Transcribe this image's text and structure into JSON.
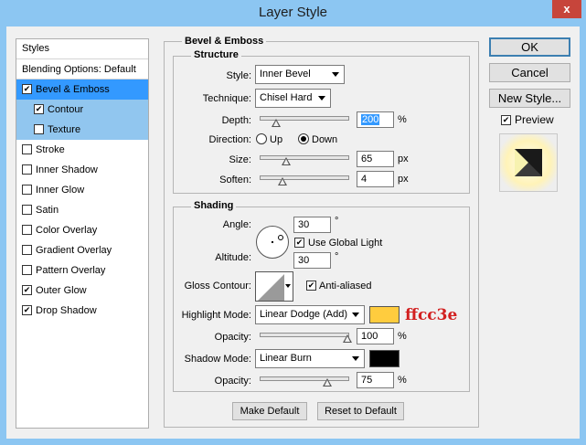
{
  "window": {
    "title": "Layer Style",
    "close_label": "x"
  },
  "styles_panel": {
    "header": "Styles",
    "blending_options": "Blending Options: Default",
    "items": [
      {
        "label": "Bevel & Emboss",
        "checked": true
      },
      {
        "label": "Contour",
        "checked": true
      },
      {
        "label": "Texture",
        "checked": false
      },
      {
        "label": "Stroke",
        "checked": false
      },
      {
        "label": "Inner Shadow",
        "checked": false
      },
      {
        "label": "Inner Glow",
        "checked": false
      },
      {
        "label": "Satin",
        "checked": false
      },
      {
        "label": "Color Overlay",
        "checked": false
      },
      {
        "label": "Gradient Overlay",
        "checked": false
      },
      {
        "label": "Pattern Overlay",
        "checked": false
      },
      {
        "label": "Outer Glow",
        "checked": true
      },
      {
        "label": "Drop Shadow",
        "checked": true
      }
    ]
  },
  "bevel": {
    "group_title": "Bevel & Emboss",
    "structure": {
      "title": "Structure",
      "style_label": "Style:",
      "style_value": "Inner Bevel",
      "technique_label": "Technique:",
      "technique_value": "Chisel Hard",
      "depth_label": "Depth:",
      "depth_value": "200",
      "depth_unit": "%",
      "direction_label": "Direction:",
      "direction_up": "Up",
      "direction_down": "Down",
      "size_label": "Size:",
      "size_value": "65",
      "size_unit": "px",
      "soften_label": "Soften:",
      "soften_value": "4",
      "soften_unit": "px"
    },
    "shading": {
      "title": "Shading",
      "angle_label": "Angle:",
      "angle_value": "30",
      "angle_unit": "°",
      "global_light_label": "Use Global Light",
      "altitude_label": "Altitude:",
      "altitude_value": "30",
      "altitude_unit": "°",
      "gloss_label": "Gloss Contour:",
      "anti_aliased_label": "Anti-aliased",
      "highlight_mode_label": "Highlight Mode:",
      "highlight_mode_value": "Linear Dodge (Add)",
      "highlight_color": "#ffcc3e",
      "highlight_annotation": "ffcc3e",
      "highlight_opacity_label": "Opacity:",
      "highlight_opacity_value": "100",
      "highlight_opacity_unit": "%",
      "shadow_mode_label": "Shadow Mode:",
      "shadow_mode_value": "Linear Burn",
      "shadow_color": "#000000",
      "shadow_opacity_label": "Opacity:",
      "shadow_opacity_value": "75",
      "shadow_opacity_unit": "%"
    },
    "make_default_label": "Make Default",
    "reset_default_label": "Reset to Default"
  },
  "actions": {
    "ok_label": "OK",
    "cancel_label": "Cancel",
    "new_style_label": "New Style...",
    "preview_label": "Preview"
  }
}
